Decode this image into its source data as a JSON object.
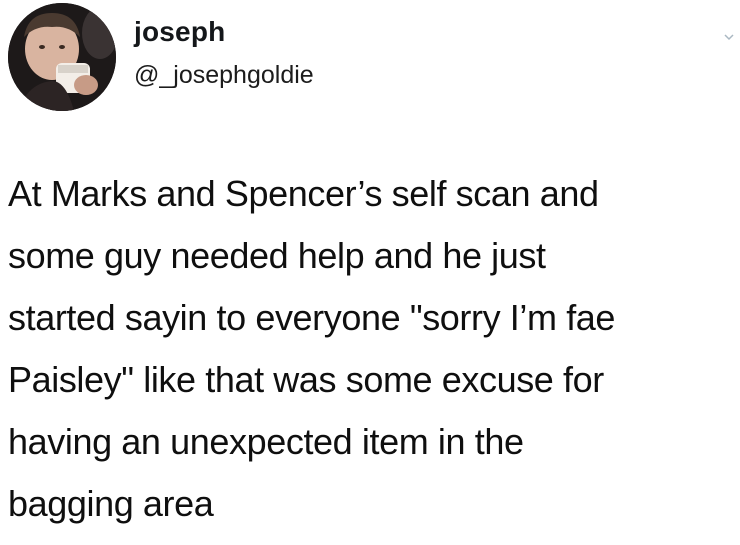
{
  "author": {
    "display_name": "joseph",
    "handle": "@_josephgoldie"
  },
  "icons": {
    "avatar": "profile-photo",
    "menu": "chevron-down-icon"
  },
  "tweet": {
    "text": "At Marks and Spencer’s self scan and\nsome guy needed help and he just\nstarted sayin to everyone \"sorry I’m fae\nPaisley\" like that was some excuse for\nhaving an unexpected item in the\nbagging area"
  },
  "colors": {
    "background": "#ffffff",
    "text": "#0f0f0f"
  }
}
